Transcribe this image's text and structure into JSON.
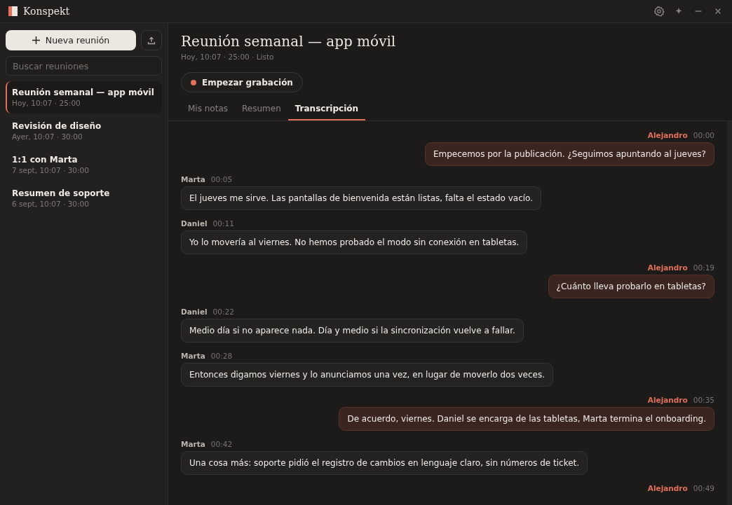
{
  "window": {
    "title": "Konspekt"
  },
  "sidebar": {
    "new_button": "Nueva reunión",
    "search": {
      "placeholder": "Buscar reuniones"
    },
    "items": [
      {
        "title": "Reunión semanal — app móvil",
        "meta": "Hoy, 10:07 · 25:00",
        "selected": true
      },
      {
        "title": "Revisión de diseño",
        "meta": "Ayer, 10:07 · 30:00",
        "selected": false
      },
      {
        "title": "1:1 con Marta",
        "meta": "7 sept, 10:07 · 30:00",
        "selected": false
      },
      {
        "title": "Resumen de soporte",
        "meta": "6 sept, 10:07 · 30:00",
        "selected": false
      }
    ]
  },
  "meeting": {
    "title": "Reunión semanal — app móvil",
    "meta": "Hoy, 10:07 · 25:00 · Listo",
    "record_button": "Empezar grabación",
    "tabs": [
      {
        "label": "Mis notas",
        "selected": false
      },
      {
        "label": "Resumen",
        "selected": false
      },
      {
        "label": "Transcripción",
        "selected": true
      }
    ]
  },
  "transcript": [
    {
      "kind": "self",
      "speaker": "Alejandro",
      "time": "00:00",
      "text": "Empecemos por la publicación. ¿Seguimos apuntando al jueves?"
    },
    {
      "kind": "other",
      "speaker": "Marta",
      "time": "00:05",
      "text": "El jueves me sirve. Las pantallas de bienvenida están listas, falta el estado vacío."
    },
    {
      "kind": "other",
      "speaker": "Daniel",
      "time": "00:11",
      "text": "Yo lo movería al viernes. No hemos probado el modo sin conexión en tabletas."
    },
    {
      "kind": "self",
      "speaker": "Alejandro",
      "time": "00:19",
      "text": "¿Cuánto lleva probarlo en tabletas?"
    },
    {
      "kind": "other",
      "speaker": "Daniel",
      "time": "00:22",
      "text": "Medio día si no aparece nada. Día y medio si la sincronización vuelve a fallar."
    },
    {
      "kind": "other",
      "speaker": "Marta",
      "time": "00:28",
      "text": "Entonces digamos viernes y lo anunciamos una vez, en lugar de moverlo dos veces."
    },
    {
      "kind": "self",
      "speaker": "Alejandro",
      "time": "00:35",
      "text": "De acuerdo, viernes. Daniel se encarga de las tabletas, Marta termina el onboarding."
    },
    {
      "kind": "other",
      "speaker": "Marta",
      "time": "00:42",
      "text": "Una cosa más: soporte pidió el registro de cambios en lenguaje claro, sin números de ticket."
    },
    {
      "kind": "self",
      "speaker": "Alejandro",
      "time": "00:49"
    }
  ]
}
